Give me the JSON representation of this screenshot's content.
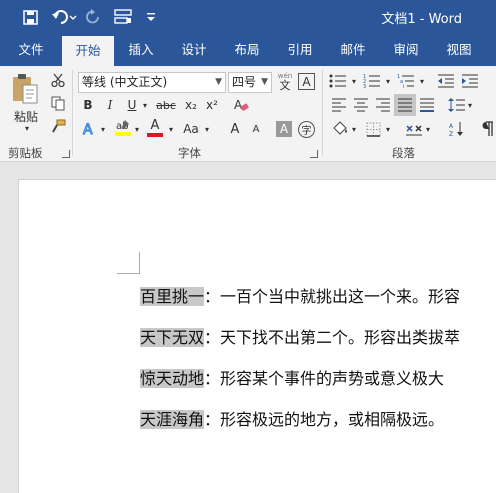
{
  "titlebar": {
    "title": "文档1 - Word"
  },
  "tabs": [
    "文件",
    "开始",
    "插入",
    "设计",
    "布局",
    "引用",
    "邮件",
    "审阅",
    "视图"
  ],
  "ribbon": {
    "paste_label": "粘贴",
    "font_name": "等线 (中文正文)",
    "font_size": "四号",
    "phonetic_top": "wén",
    "phonetic_char": "文",
    "border_char": "A",
    "bold": "B",
    "italic": "I",
    "underline": "U",
    "strike": "abc",
    "subscript": "x₂",
    "superscript": "x²",
    "font_color_letter": "A",
    "change_case": "Aa",
    "grow_font": "A",
    "shrink_font": "A",
    "shading_char": "A",
    "enclose_char": "字",
    "groups": {
      "clipboard": "剪贴板",
      "font": "字体",
      "paragraph": "段落"
    }
  },
  "document": {
    "paragraphs": [
      {
        "term": "百里挑一",
        "sep": "：",
        "rest": "一百个当中就挑出这一个来。形容"
      },
      {
        "term": "天下无双",
        "sep": "：",
        "rest": "天下找不出第二个。形容出类拔萃"
      },
      {
        "term": "惊天动地",
        "sep": "：",
        "rest": "形容某个事件的声势或意义极大"
      },
      {
        "term": "天涯海角",
        "sep": "：",
        "rest": "形容极远的地方，或相隔极远。"
      }
    ]
  }
}
